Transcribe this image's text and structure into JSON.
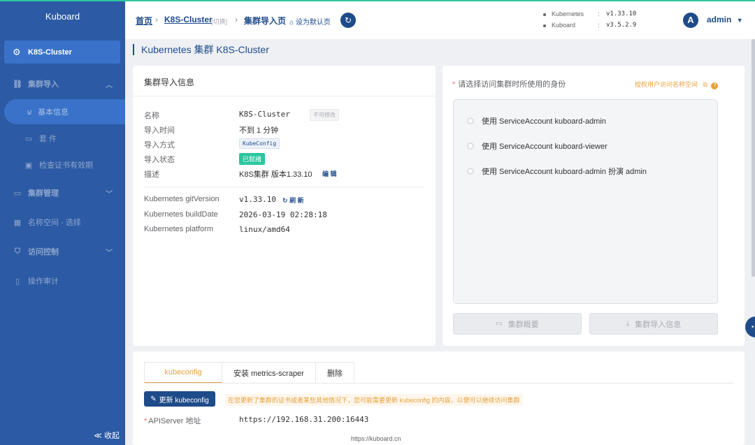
{
  "sidebar": {
    "logo": "Kuboard",
    "cluster": "K8S-Cluster",
    "menu": {
      "import_group": "集群导入",
      "basic_info": "基本信息",
      "kit": "套 件",
      "check_cert": "检查证书有效期",
      "cluster_manage": "集群管理",
      "namespace_select": "名称空间 - 选择",
      "access_control": "访问控制",
      "audit": "操作审计"
    },
    "collapse": "≪ 收起"
  },
  "header": {
    "breadcrumb": {
      "home": "首页",
      "cluster": "K8S-Cluster",
      "switch": "[切换]",
      "current": "集群导入页"
    },
    "set_default": "设为默认页",
    "versions": {
      "kubernetes_label": "Kubernetes",
      "kubernetes_value": "v1.33.10",
      "kuboard_label": "Kuboard",
      "kuboard_value": "v3.5.2.9",
      "colon": ":"
    },
    "avatar_letter": "A",
    "user": "admin"
  },
  "page_title": "Kubernetes 集群 K8S-Cluster",
  "info_card": {
    "title": "集群导入信息",
    "rows": {
      "name_label": "名称",
      "name_value": "K8S-Cluster",
      "name_tag": "不可修改",
      "import_time_label": "导入时间",
      "import_time_value": "不到 1 分钟",
      "import_method_label": "导入方式",
      "import_method_value": "KubeConfig",
      "import_status_label": "导入状态",
      "import_status_value": "已就绪",
      "desc_label": "描述",
      "desc_value": "K8S集群 版本1.33.10",
      "edit": "编 辑"
    },
    "k8s": {
      "git_version_label": "Kubernetes gitVersion",
      "git_version_value": "v1.33.10",
      "refresh": "刷 新",
      "build_date_label": "Kubernetes buildDate",
      "build_date_value": "2026-03-19 02:28:18",
      "platform_label": "Kubernetes platform",
      "platform_value": "linux/amd64"
    }
  },
  "identity_card": {
    "label": "请选择访问集群时所使用的身份",
    "auth_link": "授权用户访问名称空间",
    "options": [
      "使用 ServiceAccount kuboard-admin",
      "使用 ServiceAccount kuboard-viewer",
      "使用 ServiceAccount kuboard-admin 扮演 admin"
    ],
    "btn_overview": "集群概要",
    "btn_import_info": "集群导入信息"
  },
  "bottom_card": {
    "tabs": [
      "kubeconfig",
      "安装 metrics-scraper",
      "删除"
    ],
    "update_button": "更新 kubeconfig",
    "tip": "在您更新了集群的证书或者某些其他情况下，您可能需要更新 kubeconfig 的内容，以便可以继续访问集群",
    "api_label": "APIServer 地址",
    "api_value": "https://192.168.31.200:16443"
  },
  "footer": "https://kuboard.cn",
  "colors": {
    "sidebar_bg": "#2c5aa4",
    "brand_blue": "#1e4b8a",
    "accent_green": "#2cc79e",
    "warn_orange": "#e6a23c"
  }
}
